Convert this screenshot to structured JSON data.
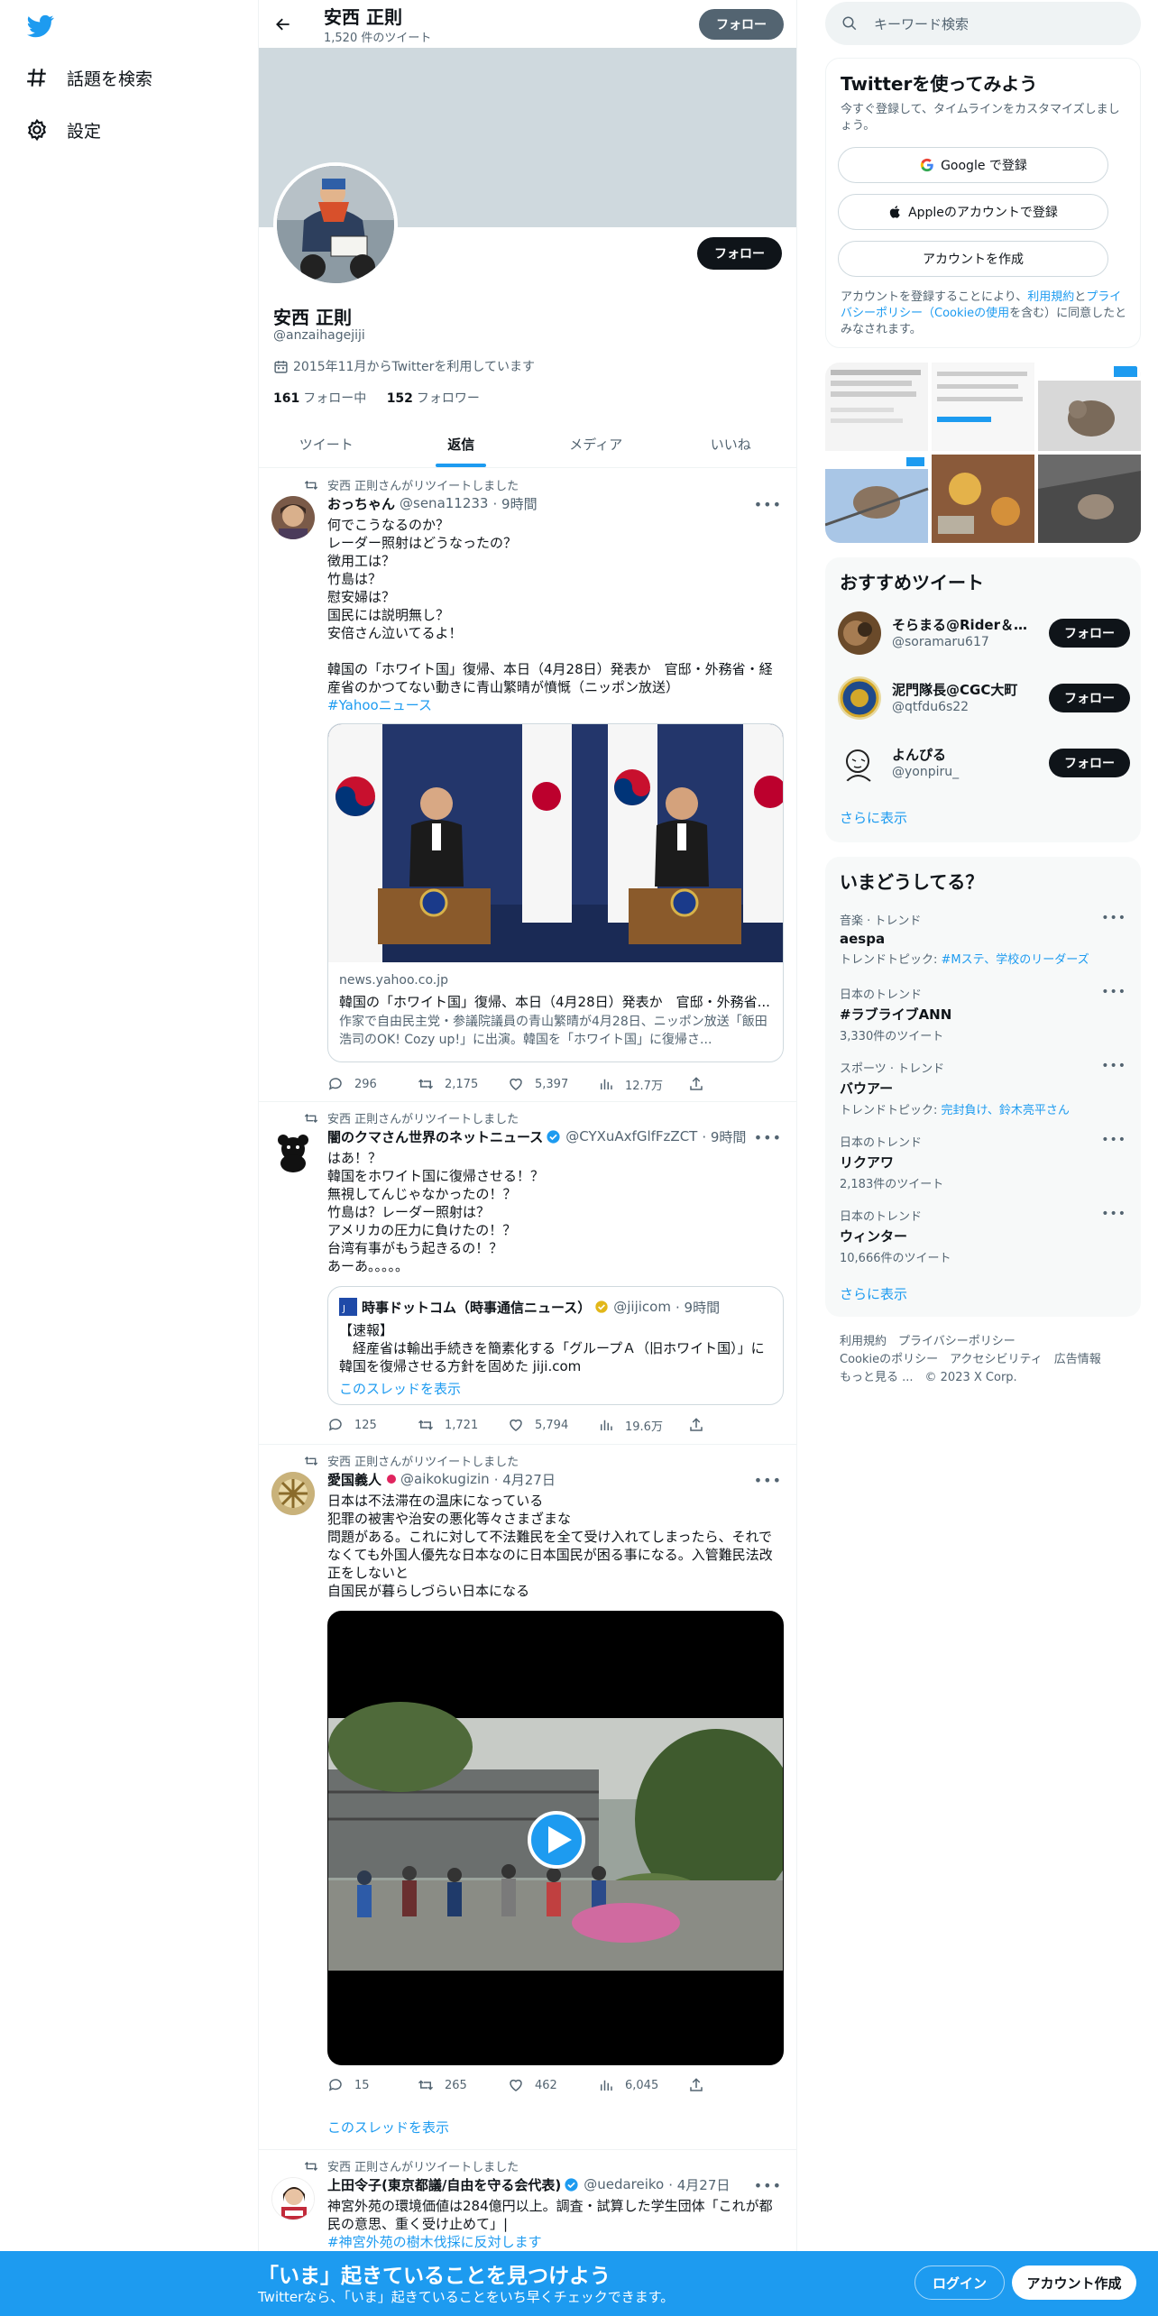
{
  "nav": {
    "explore_label": "話題を検索",
    "settings_label": "設定"
  },
  "header": {
    "name": "安西 正則",
    "tweet_count": "1,520 件のツイート",
    "follow_label": "フォロー"
  },
  "profile": {
    "name": "安西 正則",
    "handle": "@anzaihagejiji",
    "joined": "2015年11月からTwitterを利用しています",
    "following_count": "161",
    "following_label": "フォロー中",
    "followers_count": "152",
    "followers_label": "フォロワー",
    "follow_label": "フォロー"
  },
  "tabs": [
    {
      "label": "ツイート"
    },
    {
      "label": "返信"
    },
    {
      "label": "メディア"
    },
    {
      "label": "いいね"
    }
  ],
  "tweets": [
    {
      "retweet_label": "安西 正則さんがリツイートしました",
      "name": "おっちゃん",
      "handle": "@sena11233",
      "time": "· 9時間",
      "text": "何でこうなるのか？\nレーダー照射はどうなったの？\n徴用工は？\n竹島は？\n慰安婦は？\n国民には説明無し？\n安倍さん泣いてるよ！\n\n韓国の「ホワイト国」復帰、本日（4月28日）発表か　官邸・外務省・経産省のかつてない動きに青山繁晴が憤慨（ニッポン放送）",
      "link": "#Yahooニュース",
      "card_domain": "news.yahoo.co.jp",
      "card_title": "韓国の「ホワイト国」復帰、本日（4月28日）発表か　官邸・外務省...",
      "card_desc": "作家で自由民主党・参議院議員の青山繁晴が4月28日、ニッポン放送「飯田浩司のOK! Cozy up!」に出演。韓国を「ホワイト国」に復帰さ...",
      "replies": "296",
      "retweets": "2,175",
      "likes": "5,397",
      "views": "12.7万"
    },
    {
      "retweet_label": "安西 正則さんがリツイートしました",
      "name": "闇のクマさん世界のネットニュース",
      "handle": "@CYXuAxfGlfFzZCT",
      "time": "· 9時間",
      "text": "はあ！？\n韓国をホワイト国に復帰させる！？\n無視してんじゃなかったの！？\n竹島は？レーダー照射は？\nアメリカの圧力に負けたの！？\n台湾有事がもう起きるの！？\nあーあ。。。。。",
      "quote_name": "時事ドットコム（時事通信ニュース）",
      "quote_handle": "@jijicom",
      "quote_time": "· 9時間",
      "quote_text": "【速報】\n　経産省は輸出手続きを簡素化する「グループＡ（旧ホワイト国）」に韓国を復帰させる方針を固めた jiji.com",
      "quote_thread": "このスレッドを表示",
      "replies": "125",
      "retweets": "1,721",
      "likes": "5,794",
      "views": "19.6万"
    },
    {
      "retweet_label": "安西 正則さんがリツイートしました",
      "name": "愛国義人",
      "handle": "@aikokugizin",
      "time": "· 4月27日",
      "text": "日本は不法滞在の温床になっている\n犯罪の被害や治安の悪化等々さまざまな\n問題がある。これに対して不法難民を全て受け入れてしまったら、それでなくても外国人優先な日本なのに日本国民が困る事になる。入管難民法改正をしないと\n自国民が暮らしづらい日本になる",
      "replies": "15",
      "retweets": "265",
      "likes": "462",
      "views": "6,045",
      "thread": "このスレッドを表示"
    },
    {
      "retweet_label": "安西 正則さんがリツイートしました",
      "name": "上田令子(東京都議/自由を守る会代表)",
      "handle": "@uedareiko",
      "time": "· 4月27日",
      "text": "神宮外苑の環境価値は284億円以上。調査・試算した学生団体「これが都民の意思、重く受け止めて」|",
      "link": "#神宮外苑の樹木伐採に反対します"
    }
  ],
  "search": {
    "placeholder": "キーワード検索"
  },
  "signup": {
    "title": "Twitterを使ってみよう",
    "subtitle": "今すぐ登録して、タイムラインをカスタマイズしましょう。",
    "google": "Google で登録",
    "apple": "Appleのアカウントで登録",
    "create": "アカウントを作成",
    "terms_pre": "アカウントを登録することにより、",
    "terms_link1": "利用規約",
    "terms_mid": "と",
    "terms_link2": "プライバシーポリシー（Cookieの使用",
    "terms_post": "を含む）に同意したとみなされます。"
  },
  "recommended": {
    "title": "おすすめツイート",
    "users": [
      {
        "name": "そらまる@Rider＆Ar...",
        "handle": "@soramaru617",
        "follow": "フォロー"
      },
      {
        "name": "泥門隊長@CGC大町",
        "handle": "@qtfdu6s22",
        "follow": "フォロー"
      },
      {
        "name": "よんぴる",
        "handle": "@yonpiru_",
        "follow": "フォロー"
      }
    ],
    "show_more": "さらに表示"
  },
  "trends": {
    "title": "いまどうしてる？",
    "items": [
      {
        "context": "音楽 · トレンド",
        "name": "aespa",
        "extra_prefix": "トレンドトピック: ",
        "extra_link": "#Mステ、学校のリーダーズ"
      },
      {
        "context": "日本のトレンド",
        "name": "#ラブライブANN",
        "extra": "3,330件のツイート"
      },
      {
        "context": "スポーツ · トレンド",
        "name": "バウアー",
        "extra_prefix": "トレンドトピック: ",
        "extra_link": "完封負け、鈴木亮平さん"
      },
      {
        "context": "日本のトレンド",
        "name": "リクアワ",
        "extra": "2,183件のツイート"
      },
      {
        "context": "日本のトレンド",
        "name": "ウィンター",
        "extra": "10,666件のツイート"
      }
    ],
    "show_more": "さらに表示"
  },
  "footer": {
    "line1": "利用規約　プライバシーポリシー",
    "line2": "Cookieのポリシー　アクセシビリティ　広告情報",
    "line3": "もっと見る ...　© 2023 X Corp."
  },
  "bottom": {
    "title": "「いま」起きていることを見つけよう",
    "subtitle": "Twitterなら、「いま」起きていることをいち早くチェックできます。",
    "login": "ログイン",
    "signup": "アカウント作成"
  },
  "colors": {
    "accent": "#1d9bf0",
    "dark": "#0f1419",
    "muted": "#536471"
  }
}
